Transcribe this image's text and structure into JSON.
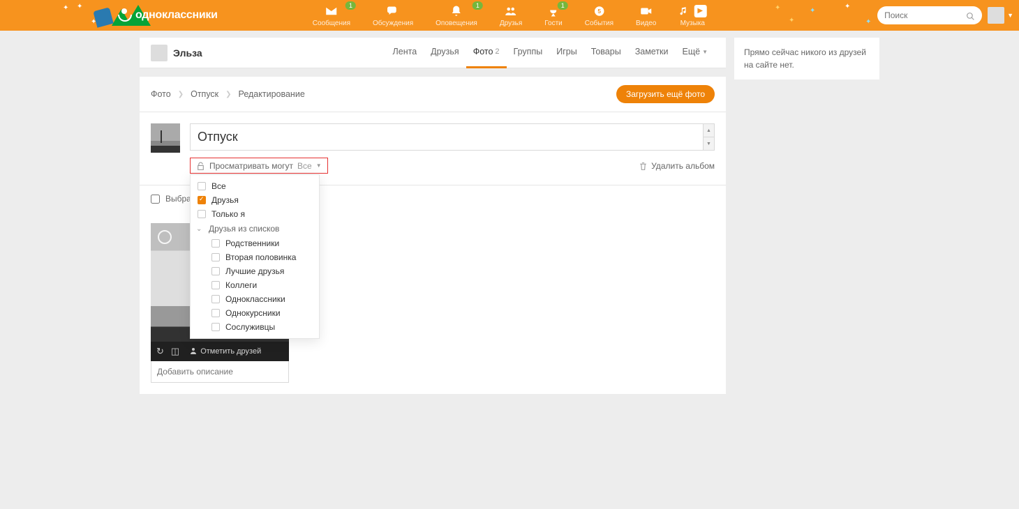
{
  "brand": "одноклассники",
  "nav": [
    {
      "label": "Сообщения",
      "badge": "1"
    },
    {
      "label": "Обсуждения",
      "badge": null
    },
    {
      "label": "Оповещения",
      "badge": "1"
    },
    {
      "label": "Друзья",
      "badge": null
    },
    {
      "label": "Гости",
      "badge": "1"
    },
    {
      "label": "События",
      "badge": null
    },
    {
      "label": "Видео",
      "badge": null
    },
    {
      "label": "Музыка",
      "badge": null
    }
  ],
  "search": {
    "placeholder": "Поиск"
  },
  "profile": {
    "name": "Эльза"
  },
  "profile_nav": {
    "items": [
      {
        "label": "Лента",
        "active": false
      },
      {
        "label": "Друзья",
        "active": false
      },
      {
        "label": "Фото",
        "count": "2",
        "active": true
      },
      {
        "label": "Группы",
        "active": false
      },
      {
        "label": "Игры",
        "active": false
      },
      {
        "label": "Товары",
        "active": false
      },
      {
        "label": "Заметки",
        "active": false
      },
      {
        "label": "Ещё",
        "dropdown": true,
        "active": false
      }
    ]
  },
  "breadcrumb": [
    "Фото",
    "Отпуск",
    "Редактирование"
  ],
  "upload_label": "Загрузить ещё фото",
  "album": {
    "title": "Отпуск",
    "privacy_label": "Просматривать могут",
    "privacy_value": "Все",
    "delete_label": "Удалить альбом"
  },
  "privacy_options": {
    "main": [
      {
        "label": "Все",
        "checked": false
      },
      {
        "label": "Друзья",
        "checked": true
      },
      {
        "label": "Только я",
        "checked": false
      }
    ],
    "group_label": "Друзья из списков",
    "sub": [
      {
        "label": "Родственники",
        "checked": false
      },
      {
        "label": "Вторая половинка",
        "checked": false
      },
      {
        "label": "Лучшие друзья",
        "checked": false
      },
      {
        "label": "Коллеги",
        "checked": false
      },
      {
        "label": "Одноклассники",
        "checked": false
      },
      {
        "label": "Однокурсники",
        "checked": false
      },
      {
        "label": "Сослуживцы",
        "checked": false
      }
    ]
  },
  "select_all_label": "Выбрать все",
  "photo": {
    "tag_label": "Отметить друзей",
    "desc_placeholder": "Добавить описание"
  },
  "sidebar_msg": "Прямо сейчас никого из друзей на сайте нет."
}
